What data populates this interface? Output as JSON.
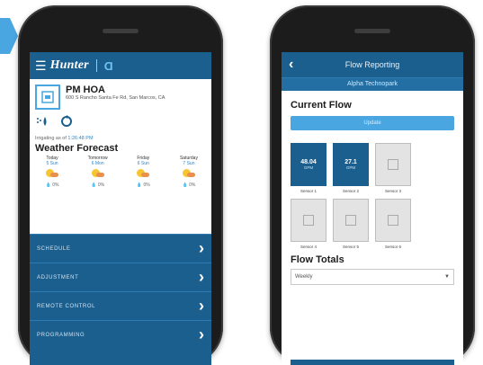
{
  "left_phone": {
    "header": {
      "menu_icon": "hamburger-icon",
      "logo_text": "Hunter",
      "logo_mark": "Ɑ"
    },
    "site": {
      "name": "PM HOA",
      "address": "600 S Rancho Santa Fe Rd, San Marcos, CA"
    },
    "icons": [
      "sprinkler-icon",
      "sync-icon"
    ],
    "status": {
      "text": "Irrigating as of",
      "link": "1:26:48 PM"
    },
    "weather_title": "Weather Forecast",
    "forecast": [
      {
        "day": "Today",
        "temp": "5 Sun"
      },
      {
        "day": "Tomorrow",
        "temp": "6 Mon"
      },
      {
        "day": "Friday",
        "temp": "6 Sun"
      },
      {
        "day": "Saturday",
        "temp": "7 Sun"
      }
    ],
    "rain": [
      "0%",
      "0%",
      "0%",
      "0%"
    ],
    "menu": [
      "SCHEDULE",
      "ADJUSTMENT",
      "REMOTE CONTROL",
      "PROGRAMMING"
    ]
  },
  "right_phone": {
    "header": {
      "back_label": "‹",
      "title": "Flow Reporting"
    },
    "subtitle": "Alpha Technopark",
    "current_flow_title": "Current Flow",
    "button_label": "Update",
    "tiles": [
      {
        "value": "48.04",
        "unit": "GPM",
        "label": "Sensor 1",
        "active": true
      },
      {
        "value": "27.1",
        "unit": "GPM",
        "label": "Sensor 2",
        "active": true
      },
      {
        "value": "",
        "unit": "",
        "label": "Sensor 3",
        "active": false
      },
      {
        "value": "",
        "unit": "",
        "label": "Sensor 4",
        "active": false
      },
      {
        "value": "",
        "unit": "",
        "label": "Sensor 5",
        "active": false
      },
      {
        "value": "",
        "unit": "",
        "label": "Sensor 6",
        "active": false
      }
    ],
    "flow_totals_title": "Flow Totals",
    "select_value": "Weekly"
  },
  "colors": {
    "header_blue": "#1b5f8f",
    "accent_blue": "#4aa6e0",
    "menu_blue": "#1b5f8f"
  }
}
